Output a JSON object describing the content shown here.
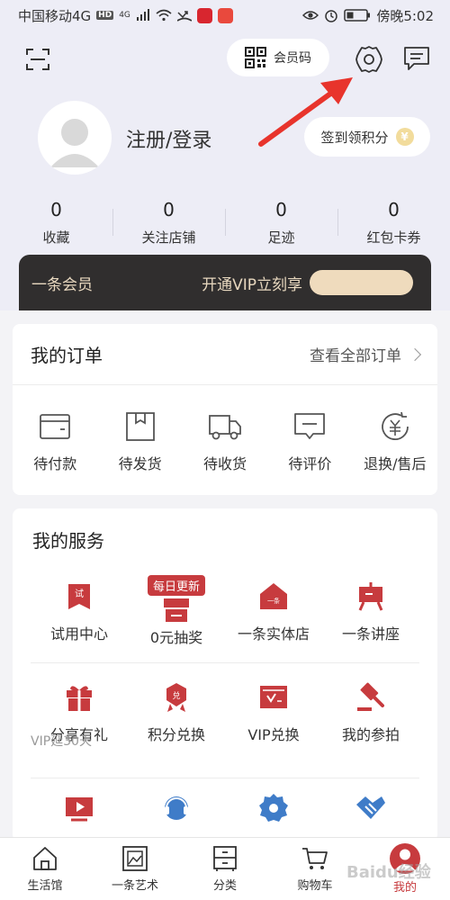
{
  "status_bar": {
    "carrier": "中国移动4G",
    "hd": "HD",
    "network": "4G",
    "time_label": "傍晚5:02"
  },
  "header": {
    "member_code_label": "会员码",
    "login_label": "注册/登录",
    "signin_label": "签到领积分",
    "coin_symbol": "¥"
  },
  "stats": [
    {
      "value": "0",
      "label": "收藏"
    },
    {
      "value": "0",
      "label": "关注店铺"
    },
    {
      "value": "0",
      "label": "足迹"
    },
    {
      "value": "0",
      "label": "红包卡券"
    }
  ],
  "vip": {
    "title": "一条会员",
    "cta": "开通VIP立刻享"
  },
  "orders": {
    "title": "我的订单",
    "view_all": "查看全部订单",
    "items": [
      {
        "label": "待付款",
        "icon": "wallet-icon"
      },
      {
        "label": "待发货",
        "icon": "package-icon"
      },
      {
        "label": "待收货",
        "icon": "truck-icon"
      },
      {
        "label": "待评价",
        "icon": "comment-icon"
      },
      {
        "label": "退换/售后",
        "icon": "refund-icon"
      }
    ]
  },
  "services": {
    "title": "我的服务",
    "badge": "每日更新",
    "trial_glyph": "试",
    "store_glyph": "一条",
    "points_glyph": "兑",
    "rows": [
      [
        {
          "label": "试用中心",
          "icon": "trial-icon"
        },
        {
          "label": "0元抽奖",
          "icon": "lottery-icon"
        },
        {
          "label": "一条实体店",
          "icon": "store-icon"
        },
        {
          "label": "一条讲座",
          "icon": "lecture-icon"
        }
      ],
      [
        {
          "label": "分享有礼",
          "icon": "gift-icon"
        },
        {
          "label": "积分兑换",
          "icon": "points-exchange-icon"
        },
        {
          "label": "VIP兑换",
          "icon": "vip-exchange-icon"
        },
        {
          "label": "我的参拍",
          "icon": "auction-icon"
        }
      ]
    ],
    "share_sub": "VIP延30天",
    "row3_icons": [
      "video-icon",
      "customer-service-icon",
      "settings-icon",
      "handshake-icon"
    ]
  },
  "tabbar": [
    {
      "label": "生活馆",
      "icon": "home-icon"
    },
    {
      "label": "一条艺术",
      "icon": "art-frame-icon"
    },
    {
      "label": "分类",
      "icon": "category-icon"
    },
    {
      "label": "购物车",
      "icon": "cart-icon"
    },
    {
      "label": "我的",
      "icon": "profile-icon"
    }
  ],
  "colors": {
    "accent": "#c73b3e",
    "vip_bg": "#302e2e",
    "vip_text": "#e8d8bf",
    "header_bg": "#ededf6"
  },
  "watermark": "Baidu经验"
}
